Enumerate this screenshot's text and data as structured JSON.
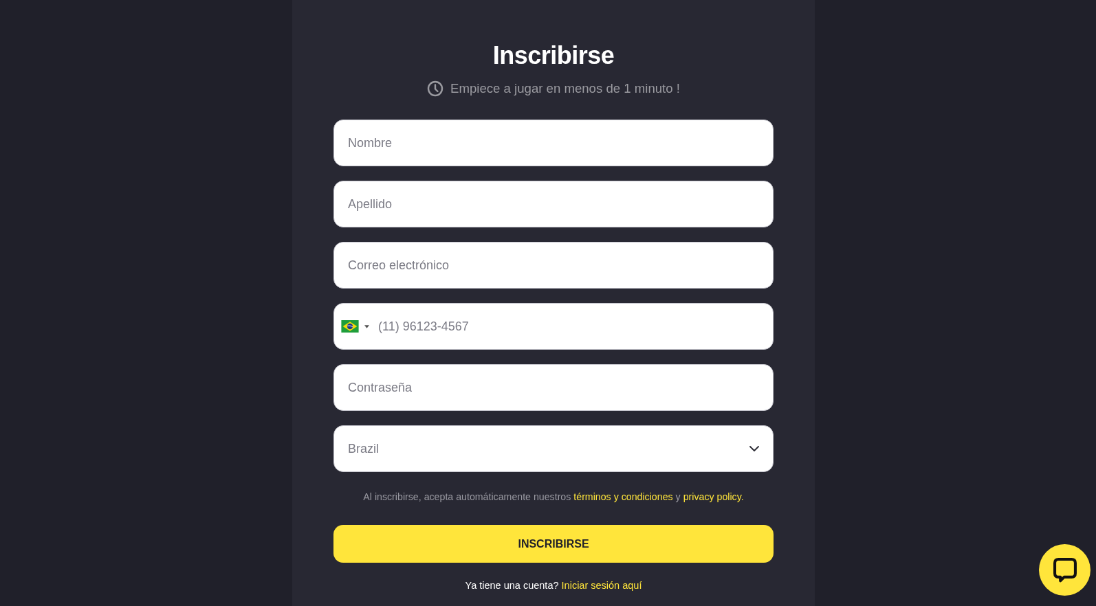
{
  "signup": {
    "title": "Inscribirse",
    "subtitle": "Empiece a jugar en menos de 1 minuto !",
    "fields": [
      {
        "kind": "text",
        "placeholder": "Nombre"
      },
      {
        "kind": "text",
        "placeholder": "Apellido"
      },
      {
        "kind": "email",
        "placeholder": "Correo electrónico"
      },
      {
        "kind": "phone",
        "placeholder": "(11) 96123-4567"
      },
      {
        "kind": "password",
        "placeholder": "Contraseña"
      },
      {
        "kind": "select",
        "value": "Brazil"
      }
    ],
    "terms": [
      {
        "kind": "text",
        "text": "Al inscribirse, acepta automáticamente nuestros"
      },
      {
        "kind": "link",
        "text": "términos y condiciones"
      },
      {
        "kind": "text",
        "text": "y"
      },
      {
        "kind": "link",
        "text": "privacy policy."
      }
    ],
    "submit_button": "INSCRIBIRSE",
    "login_prompt": [
      {
        "kind": "text",
        "text": "Ya tiene una cuenta?"
      },
      {
        "kind": "link",
        "text": "Iniciar sesión aquí"
      }
    ]
  }
}
